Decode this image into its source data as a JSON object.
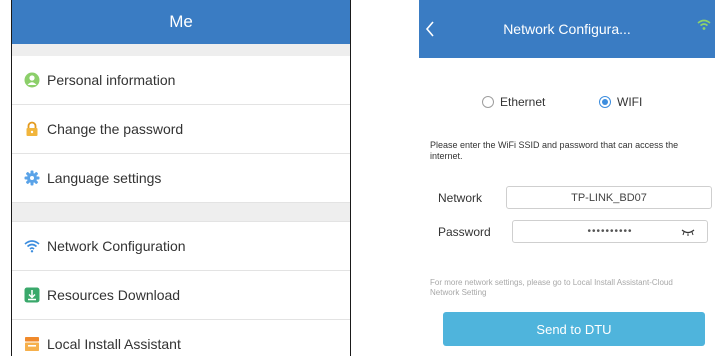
{
  "me_screen": {
    "title": "Me",
    "items": [
      {
        "label": "Personal information",
        "icon": "person-icon",
        "color": "#8ccf6a"
      },
      {
        "label": "Change the password",
        "icon": "lock-icon",
        "color": "#f1b53c"
      },
      {
        "label": "Language settings",
        "icon": "gear-icon",
        "color": "#5aa3e8"
      },
      {
        "label": "Network Configuration",
        "icon": "wifi-icon",
        "color": "#3c8dde"
      },
      {
        "label": "Resources Download",
        "icon": "download-icon",
        "color": "#3aa86b"
      },
      {
        "label": "Local Install Assistant",
        "icon": "install-icon",
        "color": "#f08a2c"
      }
    ]
  },
  "network_screen": {
    "title": "Network Configura...",
    "connection_types": [
      {
        "label": "Ethernet",
        "selected": false
      },
      {
        "label": "WIFI",
        "selected": true
      }
    ],
    "instruction": "Please enter the WiFi SSID and password that can access the internet.",
    "network_label": "Network",
    "network_value": "TP-LINK_BD07",
    "password_label": "Password",
    "password_value": "••••••••••",
    "hint": "For more network settings, please go to Local Install Assistant-Cloud Network Setting",
    "send_button": "Send to DTU"
  },
  "colors": {
    "header_blue": "#3a7cc3",
    "button_blue": "#4fb4dc",
    "radio_blue": "#3c8dde"
  }
}
